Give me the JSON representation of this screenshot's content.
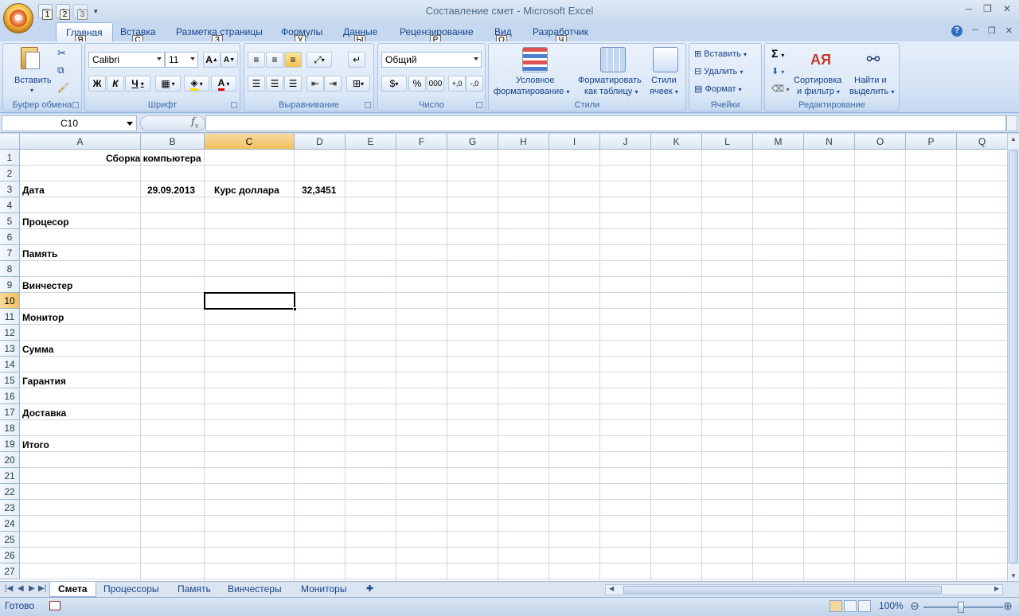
{
  "window": {
    "title": "Составление смет - Microsoft Excel",
    "qat_keytips": [
      "1",
      "2",
      "3"
    ]
  },
  "tabs": [
    {
      "label": "Главная",
      "keytip": "Я"
    },
    {
      "label": "Вставка",
      "keytip": "С"
    },
    {
      "label": "Разметка страницы",
      "keytip": "З"
    },
    {
      "label": "Формулы",
      "keytip": "У"
    },
    {
      "label": "Данные",
      "keytip": "Ы"
    },
    {
      "label": "Рецензирование",
      "keytip": "Р"
    },
    {
      "label": "Вид",
      "keytip": "О"
    },
    {
      "label": "Разработчик",
      "keytip": "Ч"
    }
  ],
  "office_keytip": "Ф",
  "ribbon": {
    "clipboard": {
      "label": "Буфер обмена",
      "paste": "Вставить"
    },
    "font": {
      "label": "Шрифт",
      "family": "Calibri",
      "size": "11",
      "bold": "Ж",
      "italic": "К",
      "underline": "Ч"
    },
    "alignment": {
      "label": "Выравнивание"
    },
    "number": {
      "label": "Число",
      "format": "Общий"
    },
    "styles": {
      "label": "Стили",
      "conditional_1": "Условное",
      "conditional_2": "форматирование",
      "format_table_1": "Форматировать",
      "format_table_2": "как таблицу",
      "cell_styles_1": "Стили",
      "cell_styles_2": "ячеек"
    },
    "cells": {
      "label": "Ячейки",
      "insert": "Вставить",
      "delete": "Удалить",
      "format": "Формат"
    },
    "editing": {
      "label": "Редактирование",
      "sort_1": "Сортировка",
      "sort_2": "и фильтр",
      "find_1": "Найти и",
      "find_2": "выделить"
    }
  },
  "formula_bar": {
    "name_box": "C10",
    "formula": ""
  },
  "columns": [
    "A",
    "B",
    "C",
    "D",
    "E",
    "F",
    "G",
    "H",
    "I",
    "J",
    "K",
    "L",
    "M",
    "N",
    "O",
    "P",
    "Q"
  ],
  "rows": [
    "1",
    "2",
    "3",
    "4",
    "5",
    "6",
    "7",
    "8",
    "9",
    "10",
    "11",
    "12",
    "13",
    "14",
    "15",
    "16",
    "17",
    "18",
    "19",
    "20",
    "21",
    "22",
    "23",
    "24",
    "25",
    "26",
    "27"
  ],
  "selected_cell": "C10",
  "cells": {
    "B1": "Сборка компьютера",
    "A3": "Дата",
    "B3": "29.09.2013",
    "C3": "Курс  доллара",
    "D3": "32,3451",
    "A5": "Процесор",
    "A7": "Память",
    "A9": "Винчестер",
    "A11": "Монитор",
    "A13": "Сумма",
    "A15": "Гарантия",
    "A17": "Доставка",
    "A19": "Итого"
  },
  "sheet_tabs": [
    "Смета",
    "Процессоры",
    "Память",
    "Винчестеры",
    "Мониторы"
  ],
  "status": {
    "text": "Готово",
    "zoom": "100%"
  }
}
